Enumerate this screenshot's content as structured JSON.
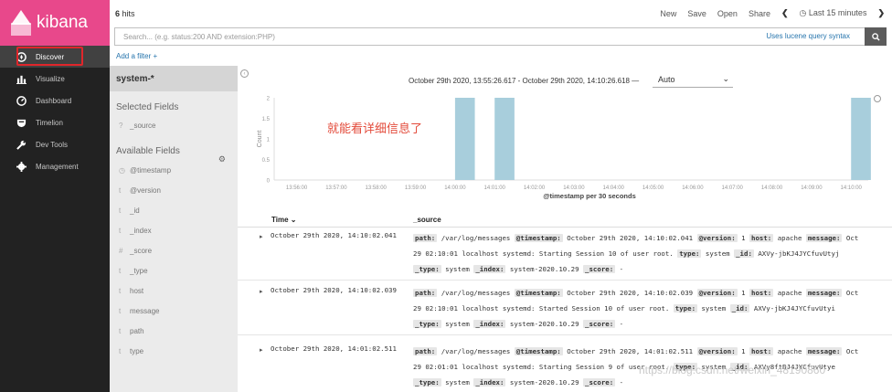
{
  "brand": {
    "name": "kibana",
    "color": "#e8488b"
  },
  "nav": [
    {
      "label": "Discover",
      "icon": "compass-icon"
    },
    {
      "label": "Visualize",
      "icon": "bar-chart-icon"
    },
    {
      "label": "Dashboard",
      "icon": "dashboard-icon"
    },
    {
      "label": "Timelion",
      "icon": "shield-icon"
    },
    {
      "label": "Dev Tools",
      "icon": "wrench-icon"
    },
    {
      "label": "Management",
      "icon": "gear-icon"
    }
  ],
  "header": {
    "hits_count": "6",
    "hits_label": " hits",
    "actions": {
      "new": "New",
      "save": "Save",
      "open": "Open",
      "share": "Share",
      "time_range": "Last 15 minutes"
    }
  },
  "search": {
    "placeholder": "Search... (e.g. status:200 AND extension:PHP)",
    "syntax_link": "Uses lucene query syntax"
  },
  "add_filter": "Add a filter +",
  "fields_panel": {
    "index_pattern": "system-*",
    "selected_title": "Selected Fields",
    "selected": [
      {
        "type": "?",
        "name": "_source"
      }
    ],
    "available_title": "Available Fields",
    "available": [
      {
        "type": "◷",
        "name": "@timestamp"
      },
      {
        "type": "t",
        "name": "@version"
      },
      {
        "type": "t",
        "name": "_id"
      },
      {
        "type": "t",
        "name": "_index"
      },
      {
        "type": "#",
        "name": "_score"
      },
      {
        "type": "t",
        "name": "_type"
      },
      {
        "type": "t",
        "name": "host"
      },
      {
        "type": "t",
        "name": "message"
      },
      {
        "type": "t",
        "name": "path"
      },
      {
        "type": "t",
        "name": "type"
      }
    ]
  },
  "time_range_text": "October 29th 2020, 13:55:26.617 - October 29th 2020, 14:10:26.618 —",
  "interval_value": "Auto",
  "annotation_text": "就能看详细信息了",
  "chart_data": {
    "type": "bar",
    "ylabel": "Count",
    "xlabel": "@timestamp per 30 seconds",
    "ylim": [
      0,
      2
    ],
    "yticks": [
      "0",
      "0.5",
      "1",
      "1.5",
      "2"
    ],
    "xticks": [
      "13:56:00",
      "13:57:00",
      "13:58:00",
      "13:59:00",
      "14:00:00",
      "14:01:00",
      "14:02:00",
      "14:03:00",
      "14:04:00",
      "14:05:00",
      "14:06:00",
      "14:07:00",
      "14:08:00",
      "14:09:00",
      "14:10:00"
    ],
    "bars": [
      {
        "x": "14:00:00",
        "value": 2
      },
      {
        "x": "14:01:00",
        "value": 2
      },
      {
        "x": "14:10:00",
        "value": 2
      }
    ],
    "bar_color": "#a8cedc",
    "grid": false
  },
  "table": {
    "col_time": "Time ⌄",
    "col_source": "_source",
    "rows": [
      {
        "time": "October 29th 2020, 14:10:02.041",
        "l1": [
          [
            "path:",
            " /var/log/messages "
          ],
          [
            "@timestamp:",
            " October 29th 2020, 14:10:02.041 "
          ],
          [
            "@version:",
            " 1 "
          ],
          [
            "host:",
            " apache "
          ],
          [
            "message:",
            " Oct"
          ]
        ],
        "l2": [
          [
            "",
            "29 02:10:01 localhost systemd: Starting Session 10 of user root. "
          ],
          [
            "type:",
            " system "
          ],
          [
            "_id:",
            " AXVy-jbKJ4JYCfuvUtyj"
          ]
        ],
        "l3": [
          [
            "_type:",
            " system "
          ],
          [
            "_index:",
            " system-2020.10.29 "
          ],
          [
            "_score:",
            " -"
          ]
        ]
      },
      {
        "time": "October 29th 2020, 14:10:02.039",
        "l1": [
          [
            "path:",
            " /var/log/messages "
          ],
          [
            "@timestamp:",
            " October 29th 2020, 14:10:02.039 "
          ],
          [
            "@version:",
            " 1 "
          ],
          [
            "host:",
            " apache "
          ],
          [
            "message:",
            " Oct"
          ]
        ],
        "l2": [
          [
            "",
            "29 02:10:01 localhost systemd: Started Session 10 of user root. "
          ],
          [
            "type:",
            " system "
          ],
          [
            "_id:",
            " AXVy-jbKJ4JYCfuvUtyi"
          ]
        ],
        "l3": [
          [
            "_type:",
            " system "
          ],
          [
            "_index:",
            " system-2020.10.29 "
          ],
          [
            "_score:",
            " -"
          ]
        ]
      },
      {
        "time": "October 29th 2020, 14:01:02.511",
        "l1": [
          [
            "path:",
            " /var/log/messages "
          ],
          [
            "@timestamp:",
            " October 29th 2020, 14:01:02.511 "
          ],
          [
            "@version:",
            " 1 "
          ],
          [
            "host:",
            " apache "
          ],
          [
            "message:",
            " Oct"
          ]
        ],
        "l2": [
          [
            "",
            "29 02:01:01 localhost systemd: Starting Session 9 of user root. "
          ],
          [
            "type:",
            " system "
          ],
          [
            "_id:",
            " AXVy8ftBJ4JYCfuvUtye"
          ]
        ],
        "l3": [
          [
            "_type:",
            " system "
          ],
          [
            "_index:",
            " system-2020.10.29 "
          ],
          [
            "_score:",
            " -"
          ]
        ]
      }
    ]
  },
  "watermark": "https://blog.csdn.net/weixin_48190860"
}
